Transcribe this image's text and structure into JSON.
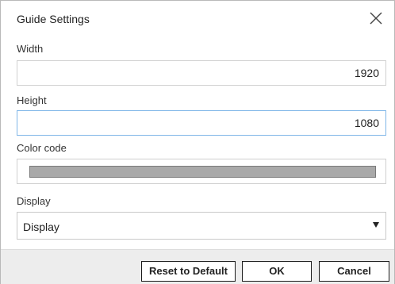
{
  "dialog": {
    "title": "Guide Settings",
    "close_icon": "close-icon"
  },
  "fields": {
    "width": {
      "label": "Width",
      "value": "1920"
    },
    "height": {
      "label": "Height",
      "value": "1080"
    },
    "color": {
      "label": "Color code",
      "value": "#a9a9a9"
    },
    "display": {
      "label": "Display",
      "selected": "Display"
    }
  },
  "buttons": {
    "reset": "Reset to Default",
    "ok": "OK",
    "cancel": "Cancel"
  }
}
